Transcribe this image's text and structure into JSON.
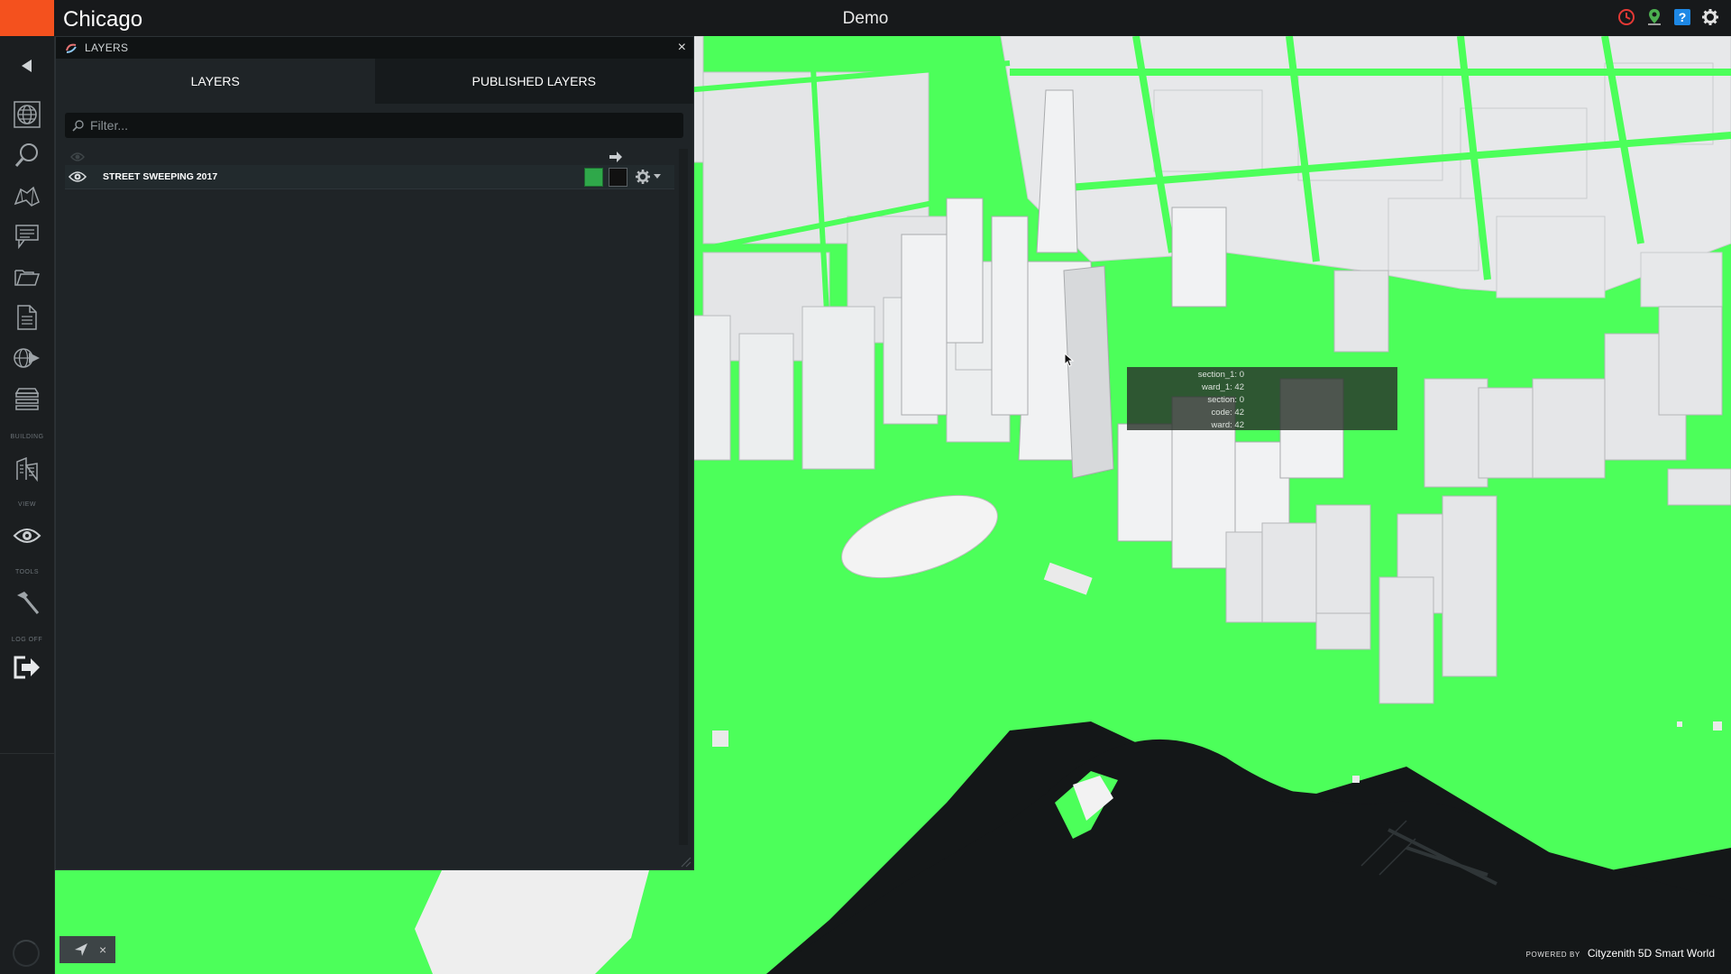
{
  "header": {
    "city": "Chicago",
    "project": "Demo",
    "icons": [
      "history-icon",
      "location-pin-icon",
      "help-icon",
      "settings-gear-icon"
    ]
  },
  "sidebar": {
    "sections": {
      "building": "BUILDING",
      "view": "VIEW",
      "tools": "TOOLS",
      "logoff": "LOG OFF"
    },
    "icons": [
      "collapse-arrow-icon",
      "globe-icon",
      "search-icon",
      "map-icon",
      "comments-icon",
      "folder-icon",
      "document-icon",
      "globe-export-icon",
      "layers-stack-icon",
      "building-icon",
      "eye-icon",
      "hammer-icon",
      "logout-icon"
    ]
  },
  "layers_panel": {
    "title": "LAYERS",
    "close": "×",
    "tabs": [
      {
        "label": "LAYERS",
        "active": true
      },
      {
        "label": "PUBLISHED LAYERS",
        "active": false
      }
    ],
    "filter_placeholder": "Filter...",
    "layers": [
      {
        "name": "STREET SWEEPING 2017",
        "visible": true,
        "fill_color": "#2fa84a",
        "line_color": "#111111"
      }
    ]
  },
  "tooltip": {
    "rows": [
      {
        "key": "section_1",
        "value": "0"
      },
      {
        "key": "ward_1",
        "value": "42"
      },
      {
        "key": "section",
        "value": "0"
      },
      {
        "key": "code",
        "value": "42"
      },
      {
        "key": "ward",
        "value": "42"
      }
    ]
  },
  "bottom": {
    "mini_close": "×",
    "powered_by": "POWERED BY",
    "product": "Cityzenith 5D Smart World"
  },
  "colors": {
    "accent": "#f4511e",
    "layer_green": "#4cff5a",
    "panel_bg": "#1f2427",
    "building": "#e6e7e8"
  }
}
